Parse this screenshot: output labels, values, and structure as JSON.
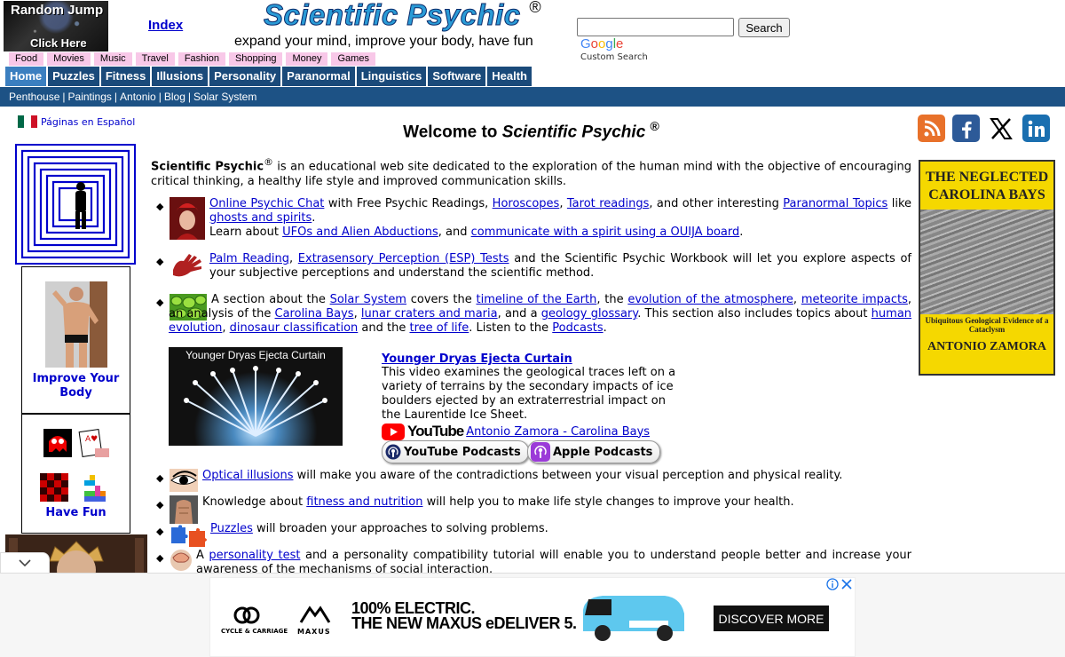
{
  "header": {
    "random_jump_line1": "Random Jump",
    "random_jump_line2": "Click Here",
    "index_label": "Index",
    "site_title": "Scientific Psychic",
    "registered": "®",
    "tagline": "expand your mind, improve your body, have fun",
    "search_button": "Search",
    "search_value": "",
    "google_logo": "Google",
    "custom_search": "Custom Search"
  },
  "categories": [
    "Food",
    "Movies",
    "Music",
    "Travel",
    "Fashion",
    "Shopping",
    "Money",
    "Games"
  ],
  "nav": [
    "Home",
    "Puzzles",
    "Fitness",
    "Illusions",
    "Personality",
    "Paranormal",
    "Linguistics",
    "Software",
    "Health"
  ],
  "nav_active": "Home",
  "subnav": [
    "Penthouse",
    "Paintings",
    "Antonio",
    "Blog",
    "Solar System"
  ],
  "left": {
    "espanol": "Páginas en Español",
    "improve": "Improve Your Body",
    "have_fun": "Have Fun"
  },
  "main": {
    "welcome_prefix": "Welcome to ",
    "welcome_name": "Scientific Psychic",
    "registered": "®",
    "intro_name": "Scientific Psychic",
    "intro_text": " is an educational web site dedicated to the exploration of the human mind with the objective of encouraging critical thinking, a healthy life style and improved communication skills.",
    "p1": {
      "l1": "Online Psychic Chat",
      "t1": " with Free Psychic Readings, ",
      "l2": "Horoscopes",
      "t2": ", ",
      "l3": "Tarot readings",
      "t3": ", and other interesting ",
      "l4": "Paranormal Topics",
      "t4": " like ",
      "l5": "ghosts and spirits",
      "t5": ".",
      "t6": "Learn about ",
      "l6": "UFOs and Alien Abductions",
      "t7": ", and ",
      "l7": "communicate with a spirit using a OUIJA board",
      "t8": "."
    },
    "p2": {
      "l1": "Palm Reading",
      "t1": ", ",
      "l2": "Extrasensory Perception (ESP) Tests",
      "t2": " and the Scientific Psychic Workbook will let you explore aspects of your subjective perceptions and understand the scientific method."
    },
    "p3": {
      "t0": "A section about the ",
      "l1": "Solar System",
      "t1": " covers the ",
      "l2": "timeline of the Earth",
      "t2": ", the ",
      "l3": "evolution of the atmosphere",
      "t3": ", ",
      "l4": "meteorite impacts",
      "t4": ", an analysis of the ",
      "l5": "Carolina Bays",
      "t5": ", ",
      "l6": "lunar craters and maria",
      "t6": ", and a ",
      "l7": "geology glossary",
      "t7": ". This section also includes topics about ",
      "l8": "human evolution",
      "t8": ", ",
      "l9": "dinosaur classification",
      "t9": " and the ",
      "l10": "tree of life",
      "t10": ". Listen to the ",
      "l11": "Podcasts",
      "t11": "."
    },
    "video": {
      "thumb_title": "Younger Dryas Ejecta Curtain",
      "title": "Younger Dryas Ejecta Curtain",
      "desc": "This video examines the geological traces left on a variety of terrains by the secondary impacts of ice boulders ejected by an extraterrestrial impact on the Laurentide Ice Sheet.",
      "youtube": "YouTube",
      "channel": " Antonio Zamora - Carolina Bays",
      "yt_podcasts": "YouTube Podcasts",
      "apple_podcasts": "Apple Podcasts"
    },
    "p4": {
      "l1": "Optical illusions",
      "t1": " will make you aware of the contradictions between your visual perception and physical reality."
    },
    "p5": {
      "t0": "Knowledge about ",
      "l1": "fitness and nutrition",
      "t1": " will help you to make life style changes to improve your health."
    },
    "p6": {
      "l1": "Puzzles",
      "t1": " will broaden your approaches to solving problems."
    },
    "p7": {
      "t0": "A ",
      "l1": "personality test",
      "t1": " and a personality compatibility tutorial will enable you to understand people better and increase your awareness of the mechanisms of social interaction."
    }
  },
  "book": {
    "title": "THE NEGLECTED CAROLINA BAYS",
    "subtitle": "Ubiquitous Geological Evidence of a Cataclysm",
    "author": "ANTONIO ZAMORA"
  },
  "ad": {
    "brand1": "CYCLE & CARRIAGE",
    "brand2": "MAXUS",
    "headline1": "100% ELECTRIC.",
    "headline2": "THE NEW MAXUS eDELIVER 5.",
    "cta": "DISCOVER MORE"
  },
  "colors": {
    "nav": "#1a4a7a",
    "nav_active": "#3b7fc0",
    "subnav": "#1d5285",
    "category": "#f8c8e8",
    "link": "#0000cc",
    "title": "#2a9bd6"
  }
}
